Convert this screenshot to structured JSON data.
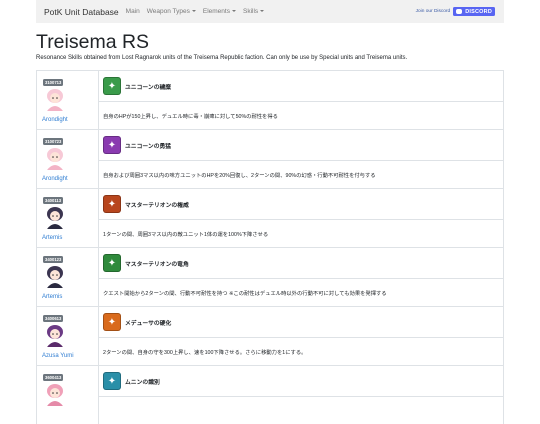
{
  "navbar": {
    "brand": "PotK Unit Database",
    "items": [
      {
        "label": "Main"
      },
      {
        "label": "Weapon Types",
        "dropdown": true
      },
      {
        "label": "Elements",
        "dropdown": true
      },
      {
        "label": "Skills",
        "dropdown": true
      }
    ],
    "discord_cta": "Join our Discord",
    "discord_logo": "DISCORD"
  },
  "page": {
    "title": "Treisema RS",
    "description": "Resonance Skills obtained from Lost Ragnarok units of the Treisema Republic faction. Can only be use by Special units and Treisema units."
  },
  "rows": [
    {
      "unit_id": "3100713",
      "unit_name": "Arondight",
      "avatar_color": "#f3b3c6",
      "hair_color": "#f7c9d6",
      "skill_name": "ユニコーンの穢糜",
      "skill_icon_color": "#3a9b4a",
      "skill_icon": "unicorn-icon",
      "skill_desc": "自身のHPが150上昇し、デュエル時に毒・崩痺に対して50%の耐性を得る"
    },
    {
      "unit_id": "3100723",
      "unit_name": "Arondight",
      "avatar_color": "#f3b3c6",
      "hair_color": "#f7c9d6",
      "skill_name": "ユニコーンの勇猛",
      "skill_icon_color": "#8a3bb0",
      "skill_icon": "unicorn-icon",
      "skill_desc": "自身および周囲3マス以内の味方ユニットのHPを20%回復し、2ターンの間、90%の幻惑・行動不可耐性を付与する"
    },
    {
      "unit_id": "3400113",
      "unit_name": "Artemis",
      "avatar_color": "#2a2a40",
      "hair_color": "#3b3550",
      "skill_name": "マスターテリオンの権威",
      "skill_icon_color": "#b8461e",
      "skill_icon": "beast-icon",
      "skill_desc": "1ターンの間、周囲3マス以内の敵ユニット1体の運を100%下降させる"
    },
    {
      "unit_id": "3400123",
      "unit_name": "Artemis",
      "avatar_color": "#2a2a40",
      "hair_color": "#3b3550",
      "skill_name": "マスターテリオンの竜角",
      "skill_icon_color": "#2f8a3c",
      "skill_icon": "beast-icon",
      "skill_desc": "クエスト開始から2ターンの間、行動不可耐性を持つ ※この耐性はデュエル時以外の行動不可に対しても効果を発揮する"
    },
    {
      "unit_id": "3400613",
      "unit_name": "Azusa Yumi",
      "avatar_color": "#5a2a6a",
      "hair_color": "#6b3a85",
      "skill_name": "メデューサの硬化",
      "skill_icon_color": "#d96a1c",
      "skill_icon": "medusa-icon",
      "skill_desc": "2ターンの間、自身の守を300上昇し、速を100下降させる。さらに移動力を1にする。"
    },
    {
      "unit_id": "3600413",
      "unit_name": "",
      "avatar_color": "#e58aa8",
      "hair_color": "#f0a0b8",
      "skill_name": "ムニンの識別",
      "skill_icon_color": "#2a8fa8",
      "skill_icon": "raven-icon",
      "skill_desc": ""
    }
  ]
}
